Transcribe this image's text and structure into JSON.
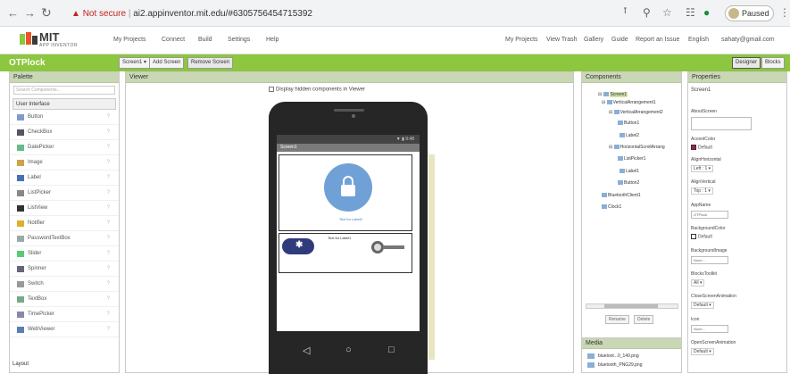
{
  "browser": {
    "security_label": "Not secure",
    "url": "ai2.appinventor.mit.edu/#6305756454715392",
    "profile_label": "Paused"
  },
  "app": {
    "logo_text": "MIT",
    "logo_subtext": "APP INVENTOR",
    "menu": [
      "My Projects",
      "Connect",
      "Build",
      "Settings",
      "Help"
    ],
    "right_menu": [
      "My Projects",
      "View Trash",
      "Gallery",
      "Guide",
      "Report an Issue",
      "English",
      "sahaty@gmail.com"
    ]
  },
  "project": {
    "name": "OTPlock",
    "buttons": [
      "Screen1 ▾",
      "Add Screen",
      "Remove Screen"
    ],
    "designer": "Designer",
    "blocks": "Blocks"
  },
  "palette": {
    "title": "Palette",
    "search_placeholder": "Search Components...",
    "category": "User Interface",
    "items": [
      "Button",
      "CheckBox",
      "DatePicker",
      "Image",
      "Label",
      "ListPicker",
      "ListView",
      "Notifier",
      "PasswordTextBox",
      "Slider",
      "Spinner",
      "Switch",
      "TextBox",
      "TimePicker",
      "WebViewer"
    ],
    "layout_category": "Layout"
  },
  "viewer": {
    "title": "Viewer",
    "checkbox_label": "Display hidden components in Viewer",
    "screen_title": "Screen1",
    "status_time": "9:48",
    "label_text": "Text for Label2",
    "label1_text": "Text for Label1"
  },
  "components": {
    "title": "Components",
    "tree": [
      "Screen1",
      "VerticalArrangement1",
      "VerticalArrangement2",
      "Button1",
      "Label2",
      "HorizontalScrollArrang",
      "ListPicker1",
      "Label1",
      "Button2",
      "BluetoothClient1",
      "Clock1"
    ],
    "rename": "Rename",
    "delete": "Delete"
  },
  "media": {
    "title": "Media",
    "files": [
      "bluetoot...0_140.png",
      "bluetooth_PNG29.png"
    ]
  },
  "properties": {
    "title": "Properties",
    "component": "Screen1",
    "items": [
      {
        "label": "AboutScreen",
        "value": ""
      },
      {
        "label": "AccentColor",
        "value": "Default"
      },
      {
        "label": "AlignHorizontal",
        "value": "Left : 1 ▾"
      },
      {
        "label": "AlignVertical",
        "value": "Top : 1 ▾"
      },
      {
        "label": "AppName",
        "value": "OTPlock"
      },
      {
        "label": "BackgroundColor",
        "value": "Default"
      },
      {
        "label": "BackgroundImage",
        "value": "None..."
      },
      {
        "label": "BlocksToolkit",
        "value": "All ▾"
      },
      {
        "label": "CloseScreenAnimation",
        "value": "Default ▾"
      },
      {
        "label": "Icon",
        "value": "None..."
      },
      {
        "label": "OpenScreenAnimation",
        "value": "Default ▾"
      }
    ]
  }
}
